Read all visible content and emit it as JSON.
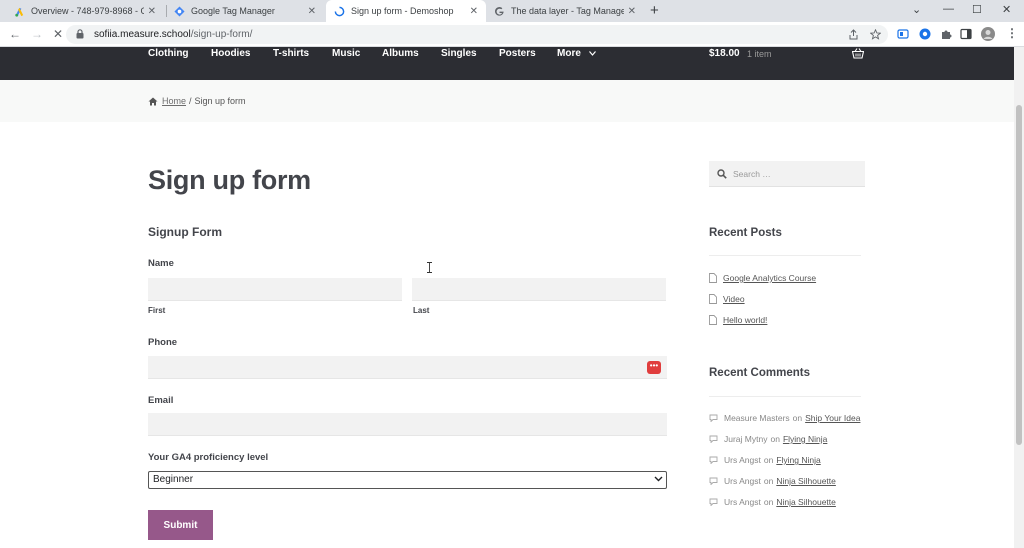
{
  "browser": {
    "tabs": [
      {
        "title": "Overview - 748-979-8968 - Goo",
        "icon": "google-ads-icon",
        "active": false
      },
      {
        "title": "Google Tag Manager",
        "icon": "tag-manager-icon",
        "active": false
      },
      {
        "title": "Sign up form - Demoshop",
        "icon": "loading-icon",
        "active": true
      },
      {
        "title": "The data layer - Tag Manager He",
        "icon": "google-icon",
        "active": false
      }
    ],
    "new_tab": "+",
    "window_controls": {
      "tab_search": "⌄",
      "minimize": "—",
      "maximize": "☐",
      "close": "✕"
    },
    "nav": {
      "back": "←",
      "forward": "→",
      "stop": "✕"
    },
    "url_host": "sofiia.measure.school",
    "url_path": "/sign-up-form/"
  },
  "site": {
    "menu": [
      "Clothing",
      "Hoodies",
      "T-shirts",
      "Music",
      "Albums",
      "Singles",
      "Posters",
      "More"
    ],
    "cart_total": "$18.00",
    "cart_count": "1 item",
    "breadcrumb": {
      "home": "Home",
      "separator": "/",
      "current": "Sign up form"
    }
  },
  "page": {
    "title": "Sign up form",
    "form": {
      "heading": "Signup Form",
      "name_label": "Name",
      "first_label": "First",
      "last_label": "Last",
      "phone_label": "Phone",
      "email_label": "Email",
      "level_label": "Your GA4 proficiency level",
      "level_selected": "Beginner",
      "submit_label": "Submit"
    }
  },
  "sidebar": {
    "search_placeholder": "Search …",
    "recent_posts_title": "Recent Posts",
    "recent_posts": [
      "Google Analytics Course",
      "Video",
      "Hello world!"
    ],
    "recent_comments_title": "Recent Comments",
    "on_word": "on",
    "recent_comments": [
      {
        "author": "Measure Masters",
        "post": "Ship Your Idea"
      },
      {
        "author": "Juraj Mytny",
        "post": "Flying Ninja"
      },
      {
        "author": "Urs Angst",
        "post": "Flying Ninja"
      },
      {
        "author": "Urs Angst",
        "post": "Ninja Silhouette"
      },
      {
        "author": "Urs Angst",
        "post": "Ninja Silhouette"
      }
    ]
  },
  "colors": {
    "nav_bg": "#2c2d33",
    "submit_bg": "#96588a",
    "badge": "#e03d3d"
  }
}
